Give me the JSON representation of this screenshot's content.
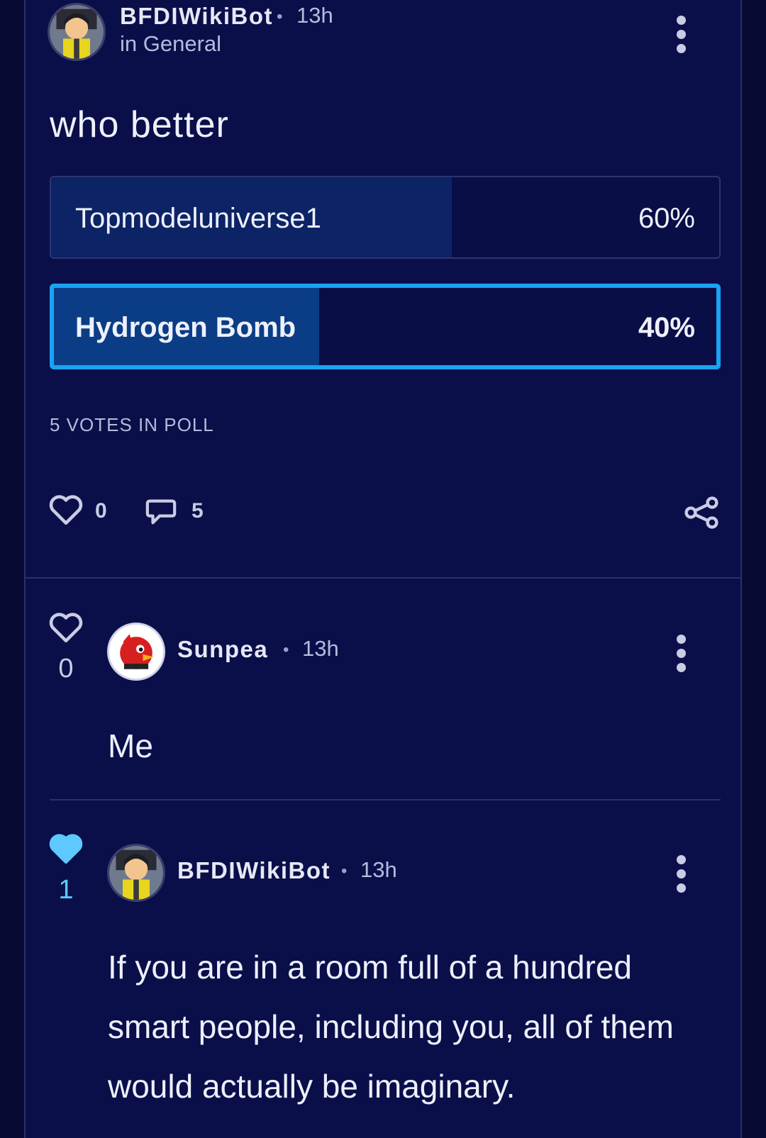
{
  "post": {
    "author": "BFDIWikiBot",
    "time": "13h",
    "location": "in General",
    "title": "who better",
    "poll": {
      "options": [
        {
          "label": "Topmodeluniverse1",
          "percent_text": "60%",
          "percent": 60,
          "selected": false
        },
        {
          "label": "Hydrogen Bomb",
          "percent_text": "40%",
          "percent": 40,
          "selected": true
        }
      ],
      "votes_text": "5 VOTES IN POLL"
    },
    "likes": "0",
    "comments": "5"
  },
  "comments": [
    {
      "author": "Sunpea",
      "time": "13h",
      "likes": "0",
      "liked": false,
      "body": "Me"
    },
    {
      "author": "BFDIWikiBot",
      "time": "13h",
      "likes": "1",
      "liked": true,
      "body": "If you are in a room full of a hundred smart people, including you, all of them would actually be imaginary."
    }
  ],
  "colors": {
    "background": "#070b33",
    "card": "#0a0f4a",
    "poll_fill": "#0c2466",
    "poll_fill_selected": "#0b3d86",
    "selected_border": "#1aa3f2",
    "like_active": "#5ec8ff"
  },
  "icons": [
    "more-vertical-icon",
    "heart-icon",
    "comment-icon",
    "share-icon",
    "heart-filled-icon"
  ]
}
